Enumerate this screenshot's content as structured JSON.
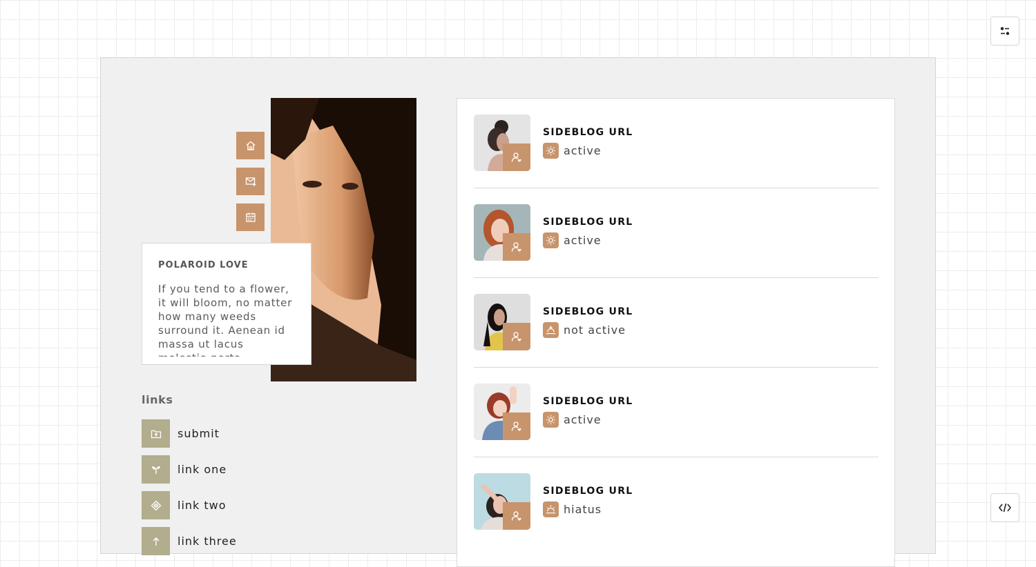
{
  "about": {
    "title": "POLAROID LOVE",
    "text": "If you tend to a flower, it will bloom, no matter how many weeds surround it. Aenean id massa ut lacus molestie porta."
  },
  "nav_icons": [
    "home-icon",
    "mail-plus-icon",
    "calendar-icon"
  ],
  "links": {
    "title": "links",
    "items": [
      {
        "label": "submit",
        "icon": "folder-upload-icon"
      },
      {
        "label": "link one",
        "icon": "sprout-icon"
      },
      {
        "label": "link two",
        "icon": "compass-icon"
      },
      {
        "label": "link three",
        "icon": "arrow-up-icon"
      }
    ]
  },
  "sideblogs": [
    {
      "url": "SIDEBLOG URL",
      "status": "active",
      "status_icon": "sun-icon"
    },
    {
      "url": "SIDEBLOG URL",
      "status": "active",
      "status_icon": "sun-icon"
    },
    {
      "url": "SIDEBLOG URL",
      "status": "not active",
      "status_icon": "sunset-icon"
    },
    {
      "url": "SIDEBLOG URL",
      "status": "active",
      "status_icon": "sun-icon"
    },
    {
      "url": "SIDEBLOG URL",
      "status": "hiatus",
      "status_icon": "sunrise-icon"
    }
  ],
  "colors": {
    "accent": "#c8946c",
    "link_icon_bg": "#b1ad8d",
    "panel_bg": "#f0f0f0",
    "text_dark": "#111111"
  },
  "toolbar": {
    "top_icon": "sliders-icon",
    "bottom_icon": "code-icon"
  }
}
